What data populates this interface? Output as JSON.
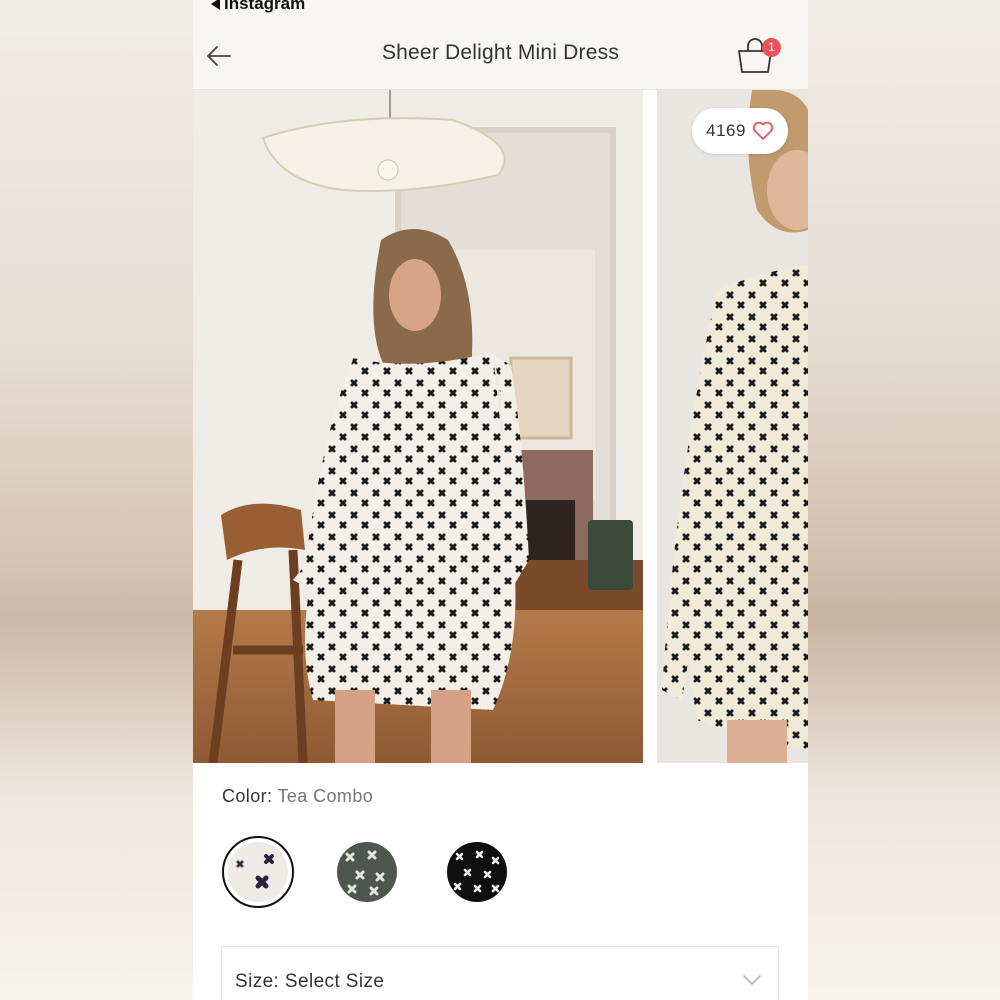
{
  "status_bar": {
    "back_app_label": "Instagram"
  },
  "header": {
    "title": "Sheer Delight Mini Dress",
    "cart_count": "1"
  },
  "gallery": {
    "like_count": "4169"
  },
  "color": {
    "label": "Color:",
    "value": "Tea Combo"
  },
  "swatches": [
    {
      "name": "tea-combo",
      "selected": true
    },
    {
      "name": "grey-combo",
      "selected": false
    },
    {
      "name": "black-combo",
      "selected": false
    }
  ],
  "size": {
    "label": "Size: Select Size"
  },
  "icons": [
    "back-arrow-icon",
    "shopping-bag-icon",
    "heart-icon",
    "chevron-down-icon"
  ],
  "colors": {
    "badge": "#e9545a",
    "heart": "#e9545a",
    "header_bg": "#f8f6f3"
  }
}
